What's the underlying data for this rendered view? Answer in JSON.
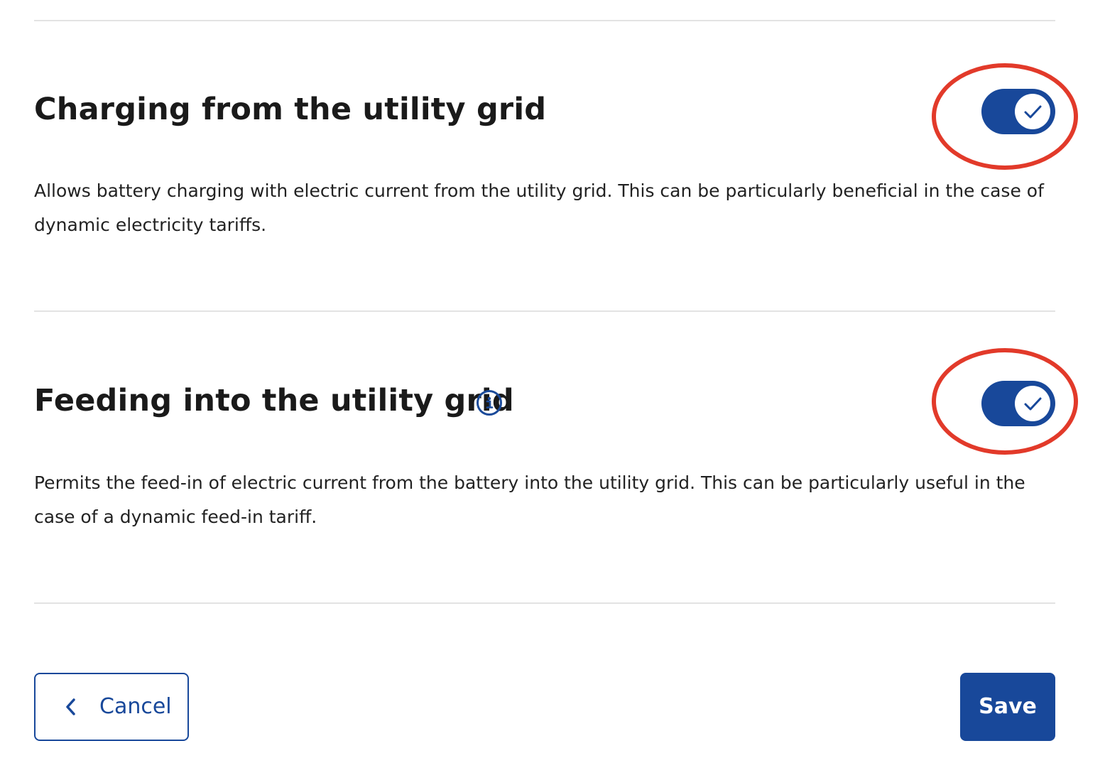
{
  "sections": [
    {
      "title": "Charging from the utility grid",
      "description": "Allows battery charging with electric current from the utility grid. This can be particularly beneficial in the case of dynamic electricity tariffs.",
      "toggle_on": true,
      "has_info_icon": false
    },
    {
      "title": "Feeding into the utility grid",
      "description": "Permits the feed-in of electric current from the battery into the utility grid. This can be particularly useful in the case of a dynamic feed-in tariff.",
      "toggle_on": true,
      "has_info_icon": true
    }
  ],
  "footer": {
    "cancel_label": "Cancel",
    "save_label": "Save"
  },
  "icons": {
    "toggle_knob": "check-icon",
    "info": "info-icon",
    "cancel": "chevron-left-icon"
  },
  "colors": {
    "primary": "#18489a",
    "annotation": "#e23a2a",
    "divider": "#e3e3e3",
    "text": "#1a1a1a"
  }
}
